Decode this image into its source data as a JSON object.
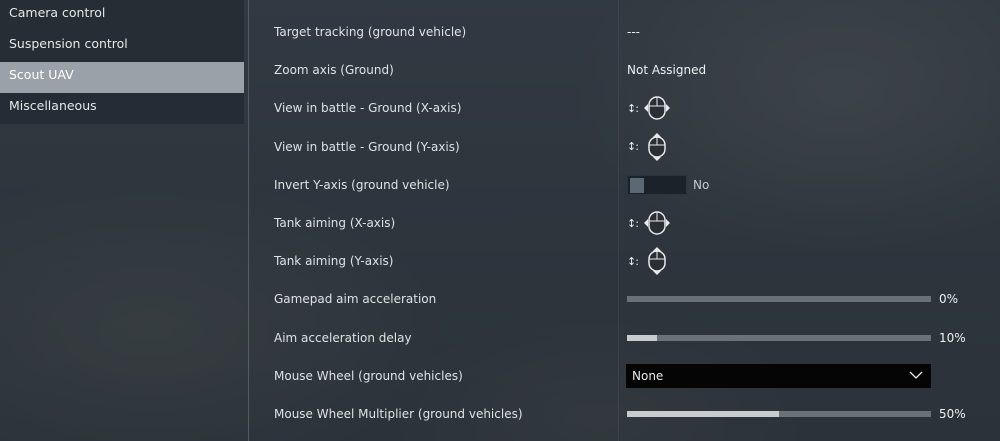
{
  "sidebar": {
    "items": [
      {
        "label": "Camera control",
        "selected": false
      },
      {
        "label": "Suspension control",
        "selected": false
      },
      {
        "label": "Scout UAV",
        "selected": true
      },
      {
        "label": "Miscellaneous",
        "selected": false
      }
    ]
  },
  "settings": {
    "target_tracking": {
      "label": "Target tracking (ground vehicle)",
      "value": "---"
    },
    "zoom_axis": {
      "label": "Zoom axis (Ground)",
      "value": "Not Assigned"
    },
    "view_x": {
      "label": "View in battle - Ground (X-axis)",
      "prefix": "↕:",
      "icon": "mouse-horizontal-axis-icon"
    },
    "view_y": {
      "label": "View in battle - Ground (Y-axis)",
      "prefix": "↕:",
      "icon": "mouse-vertical-axis-icon"
    },
    "invert_y": {
      "label": "Invert Y-axis (ground vehicle)",
      "state": "No"
    },
    "tank_aim_x": {
      "label": "Tank aiming (X-axis)",
      "prefix": "↕:",
      "icon": "mouse-horizontal-axis-icon"
    },
    "tank_aim_y": {
      "label": "Tank aiming (Y-axis)",
      "prefix": "↕:",
      "icon": "mouse-vertical-axis-icon"
    },
    "aim_accel": {
      "label": "Gamepad aim acceleration",
      "value_text": "0%",
      "fraction": 0.0
    },
    "aim_delay": {
      "label": "Aim acceleration delay",
      "value_text": "10%",
      "fraction": 0.1
    },
    "mouse_wheel": {
      "label": "Mouse Wheel (ground vehicles)",
      "selected": "None"
    },
    "wheel_mult": {
      "label": "Mouse Wheel Multiplier (ground vehicles)",
      "value_text": "50%",
      "fraction": 0.5
    }
  },
  "colors": {
    "selected_bg": "#9aa1a9",
    "dropdown_bg": "#050505",
    "slider_track": "#6b7178",
    "slider_fill": "#c9ccce"
  }
}
